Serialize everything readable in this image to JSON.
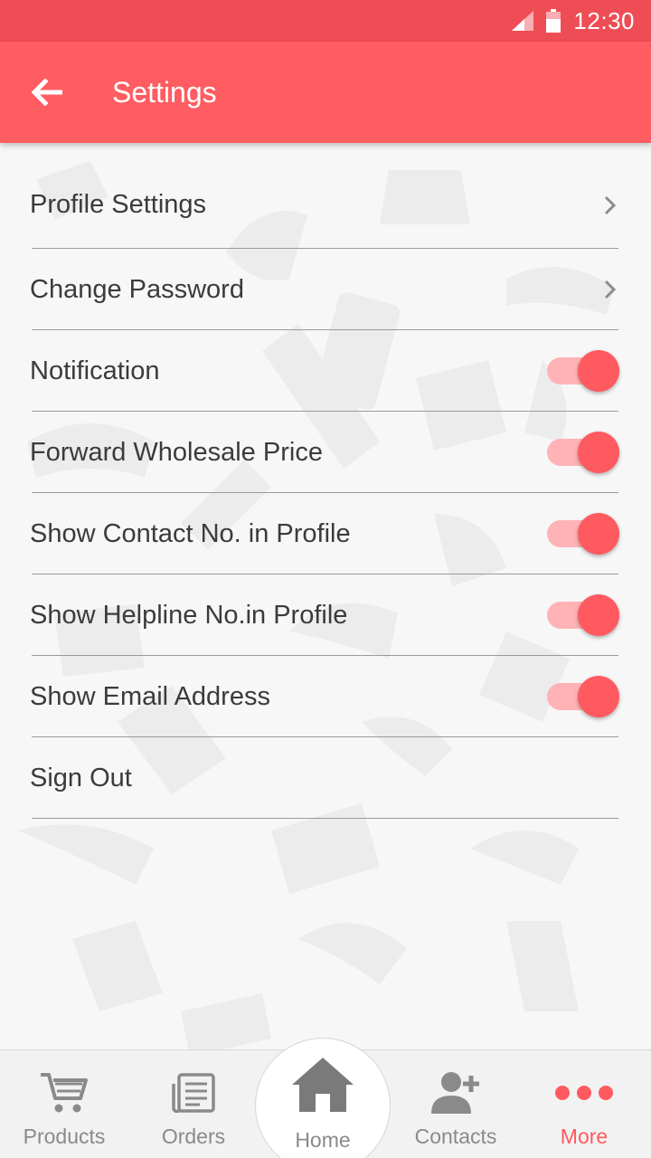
{
  "status_bar": {
    "time": "12:30"
  },
  "header": {
    "title": "Settings"
  },
  "settings": [
    {
      "label": "Profile Settings",
      "type": "link"
    },
    {
      "label": "Change Password",
      "type": "link"
    },
    {
      "label": "Notification",
      "type": "toggle",
      "on": true
    },
    {
      "label": "Forward Wholesale Price",
      "type": "toggle",
      "on": true
    },
    {
      "label": "Show Contact No. in Profile",
      "type": "toggle",
      "on": true
    },
    {
      "label": "Show Helpline No.in Profile",
      "type": "toggle",
      "on": true
    },
    {
      "label": "Show Email Address",
      "type": "toggle",
      "on": true
    },
    {
      "label": "Sign Out",
      "type": "action"
    }
  ],
  "bottom_nav": {
    "items": [
      {
        "label": "Products",
        "icon": "cart-icon"
      },
      {
        "label": "Orders",
        "icon": "orders-icon"
      },
      {
        "label": "Home",
        "icon": "home-icon"
      },
      {
        "label": "Contacts",
        "icon": "add-contact-icon"
      },
      {
        "label": "More",
        "icon": "more-dots-icon",
        "active": true
      }
    ]
  },
  "colors": {
    "status_bar": "#ef4d55",
    "app_bar": "#ff5d62",
    "accent": "#ff5a60",
    "toggle_track": "#ffb3b6",
    "nav_inactive": "#8a8a8a"
  }
}
